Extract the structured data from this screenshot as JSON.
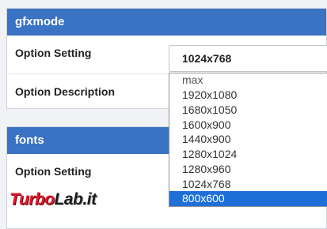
{
  "panels": [
    {
      "header": "gfxmode",
      "rows": [
        "Option Setting",
        "Option Description"
      ]
    },
    {
      "header": "fonts",
      "rows": [
        "Option Setting"
      ]
    }
  ],
  "select": {
    "value": "1024x768",
    "options": [
      "max",
      "1920x1080",
      "1680x1050",
      "1600x900",
      "1440x900",
      "1280x1024",
      "1280x960",
      "1024x768",
      "800x600"
    ],
    "highlighted": "800x600"
  },
  "watermark": {
    "part1": "Turbo",
    "part2": "Lab.it"
  },
  "colors": {
    "header": "#3a73c3",
    "highlight": "#1f6fd6",
    "logo_red": "#e4162b"
  }
}
